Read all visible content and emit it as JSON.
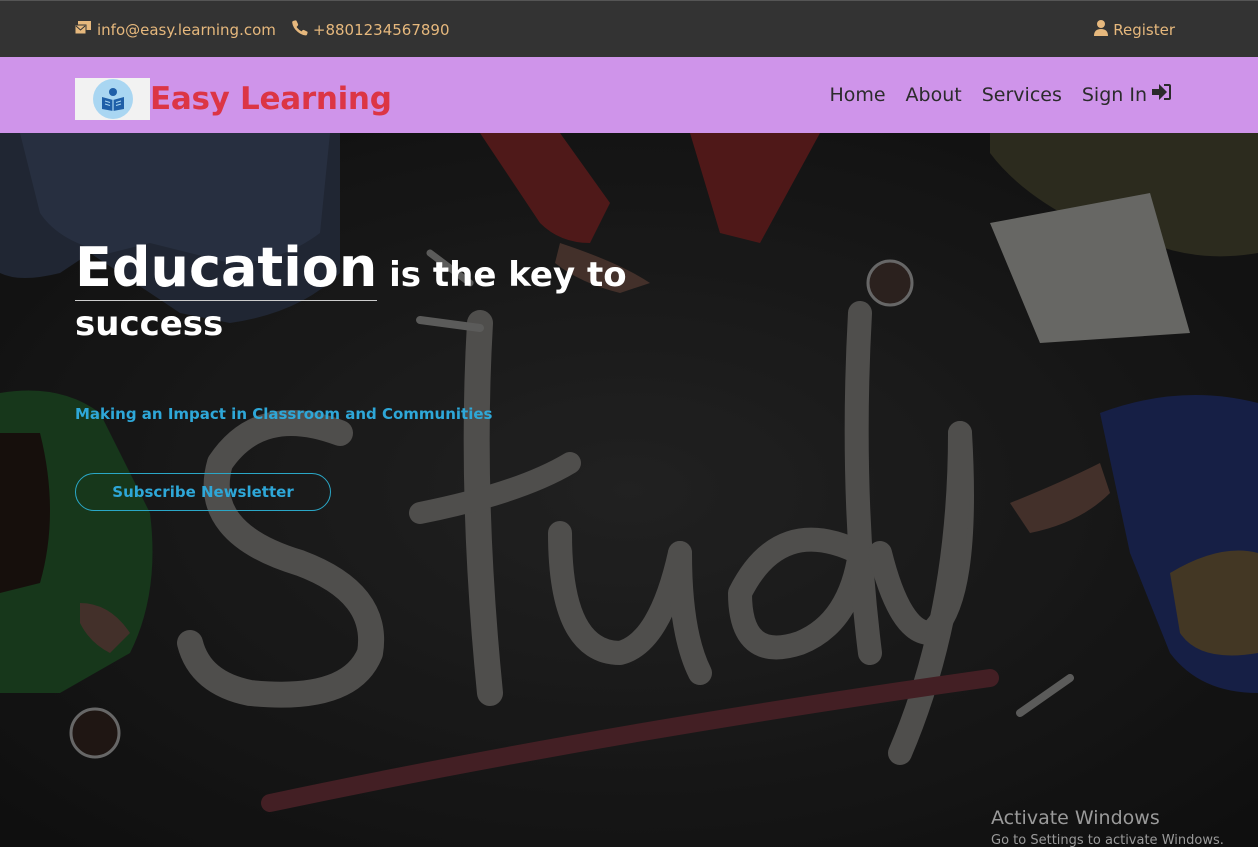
{
  "topbar": {
    "email": "info@easy.learning.com",
    "phone": "+8801234567890",
    "register_label": "Register",
    "icons": [
      "envelope-icon",
      "phone-icon",
      "user-icon"
    ],
    "text_color": "#e6b87d",
    "background": "#333333"
  },
  "navbar": {
    "brand_name": "Easy Learning",
    "brand_color": "#dc3545",
    "background": "#cf94ea",
    "links": [
      {
        "label": "Home"
      },
      {
        "label": "About"
      },
      {
        "label": "Services"
      },
      {
        "label": "Sign In",
        "icon": "sign-in-icon"
      }
    ]
  },
  "hero": {
    "headline_big": "Education",
    "headline_rest": " is the key to",
    "headline_line2": "success",
    "tagline": "Making an Impact in Classroom and Communities",
    "tagline_color": "#2ea7d8",
    "button_label": "Subscribe Newsletter",
    "background_image": "chalkboard-study-photo"
  },
  "os_watermark": {
    "title": "Activate Windows",
    "subtitle": "Go to Settings to activate Windows."
  }
}
